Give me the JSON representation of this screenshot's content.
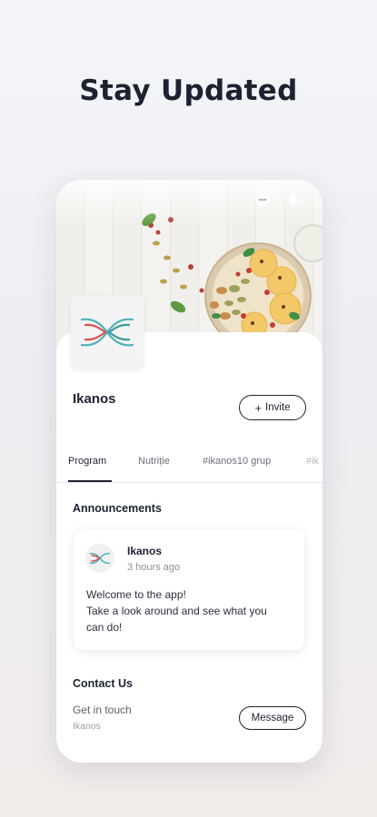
{
  "headline": "Stay Updated",
  "header_icons": [
    "chat-icon",
    "bell-icon"
  ],
  "profile": {
    "name": "Ikanos",
    "invite_label": "Invite",
    "invite_icon": "plus-icon"
  },
  "tabs": [
    {
      "label": "Program",
      "active": true
    },
    {
      "label": "Nutriție",
      "active": false
    },
    {
      "label": "#ikanos10 grup",
      "active": false
    },
    {
      "label": "#ik",
      "active": false
    }
  ],
  "announcements": {
    "title": "Announcements",
    "post": {
      "author": "Ikanos",
      "time": "3 hours ago",
      "lines": [
        "Welcome to the app!",
        "Take a look around and see what you",
        "can do!"
      ]
    }
  },
  "contact": {
    "title": "Contact Us",
    "subtitle": "Get in touch",
    "owner": "Ikanos",
    "message_label": "Message"
  },
  "colors": {
    "logo_teal": "#4fb3b8",
    "logo_red": "#d9534f",
    "text_dark": "#1d2330"
  }
}
